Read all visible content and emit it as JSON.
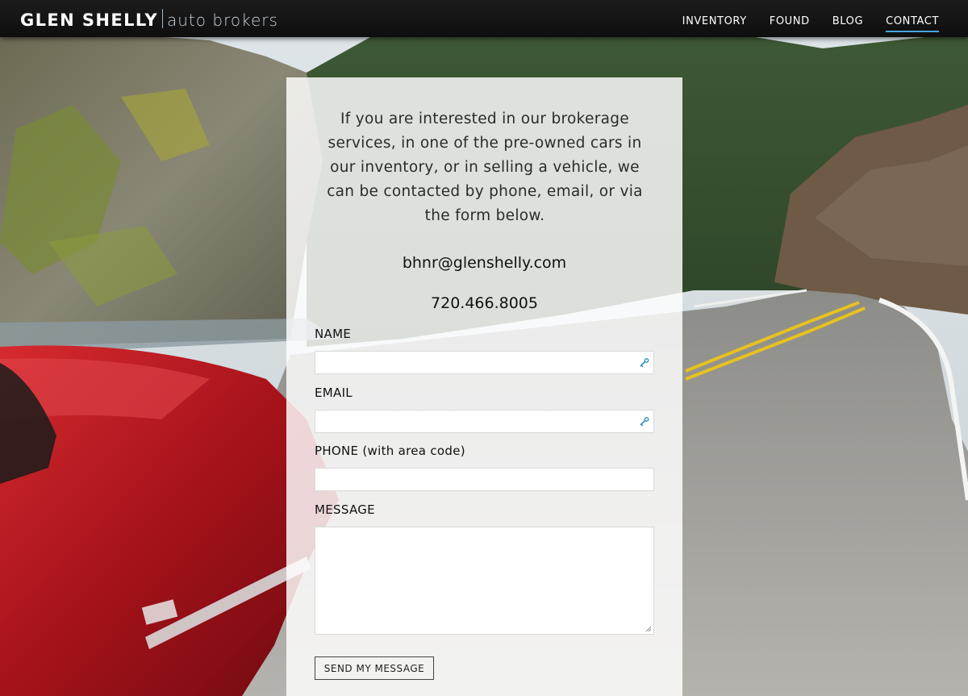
{
  "header": {
    "logo_main": "GLEN SHELLY",
    "logo_sub": "auto brokers",
    "nav": [
      {
        "label": "INVENTORY"
      },
      {
        "label": "FOUND"
      },
      {
        "label": "BLOG"
      },
      {
        "label": "CONTACT",
        "active": true
      }
    ],
    "accent_color": "#4aa3df"
  },
  "panel": {
    "intro": "If you are interested in our brokerage services, in one of the pre-owned cars in our inventory, or in selling a vehicle, we can be contacted by phone, email, or via the form below.",
    "email": "bhnr@glenshelly.com",
    "phone": "720.466.8005"
  },
  "form": {
    "name_label": "NAME",
    "email_label": "EMAIL",
    "phone_label": "PHONE (with area code)",
    "message_label": "MESSAGE",
    "name_value": "",
    "email_value": "",
    "phone_value": "",
    "message_value": "",
    "autofill_icon": "autofill-key-icon",
    "submit_label": "SEND MY MESSAGE"
  }
}
